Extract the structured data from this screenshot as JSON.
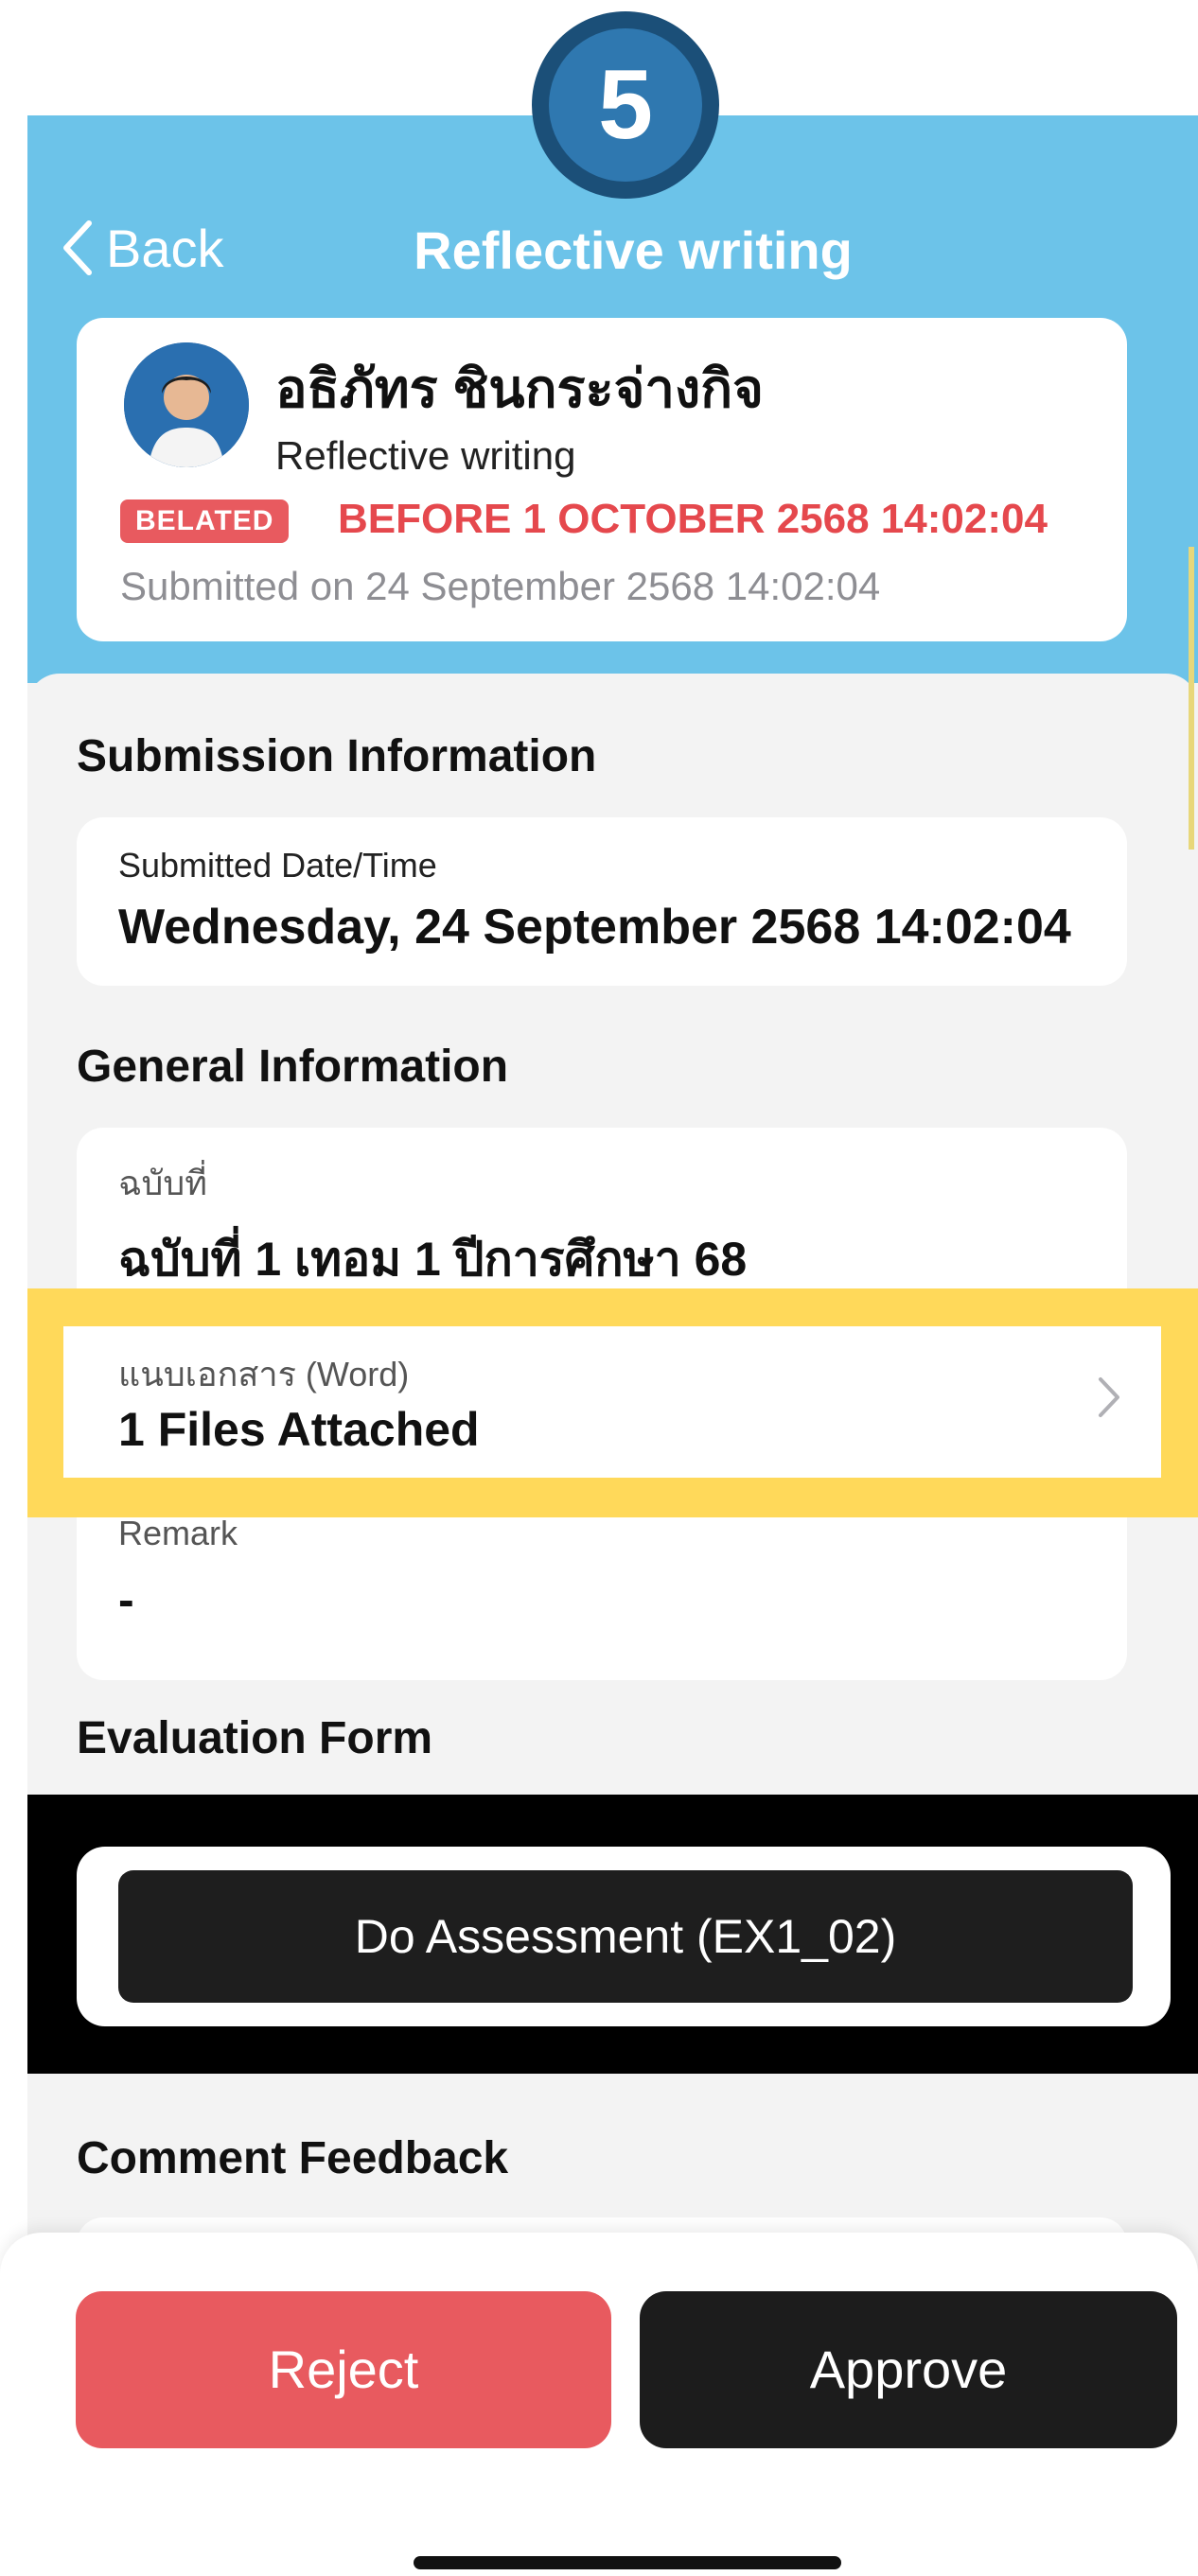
{
  "step_badge": "5",
  "header": {
    "back_label": "Back",
    "title": "Reflective writing"
  },
  "profile": {
    "name": "อธิภัทร ชินกระจ่างกิจ",
    "assignment": "Reflective writing",
    "status_badge": "BELATED",
    "deadline": "BEFORE 1 OCTOBER 2568 14:02:04",
    "submitted_on": "Submitted on 24 September 2568 14:02:04"
  },
  "submission_info": {
    "section_title": "Submission Information",
    "label": "Submitted Date/Time",
    "value": "Wednesday, 24 September 2568 14:02:04"
  },
  "general_info": {
    "section_title": "General Information",
    "issue_label": "ฉบับที่",
    "issue_value": "ฉบับที่ 1 เทอม 1 ปีการศึกษา 68",
    "attachment_label": "แนบเอกสาร (Word)",
    "attachment_value": "1 Files Attached",
    "remark_label": "Remark",
    "remark_value": "-"
  },
  "evaluation": {
    "section_title": "Evaluation Form",
    "button_label": "Do Assessment (EX1_02)"
  },
  "comment": {
    "section_title": "Comment Feedback"
  },
  "actions": {
    "reject_label": "Reject",
    "approve_label": "Approve"
  },
  "colors": {
    "header_blue": "#6cc3e9",
    "badge_blue": "#2f78b0",
    "danger_red": "#e85a5f",
    "highlight_yellow": "#ffd95a",
    "dark_button": "#1c1c1c"
  }
}
